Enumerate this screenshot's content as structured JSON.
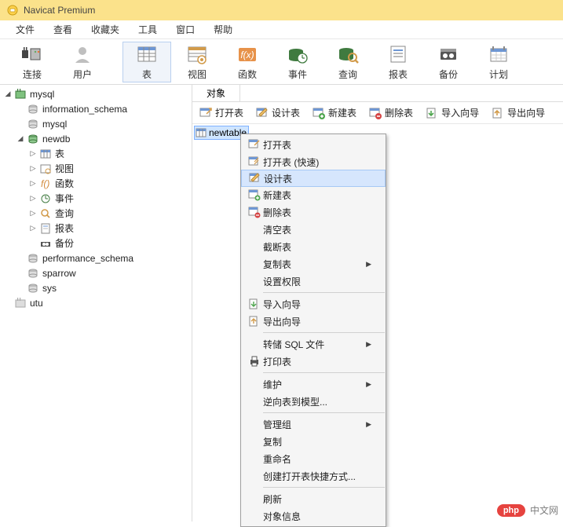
{
  "title": "Navicat Premium",
  "menubar": [
    "文件",
    "查看",
    "收藏夹",
    "工具",
    "窗口",
    "帮助"
  ],
  "toolbar": [
    {
      "id": "connect",
      "label": "连接",
      "icon": "plug"
    },
    {
      "id": "user",
      "label": "用户",
      "icon": "user"
    },
    {
      "id": "table",
      "label": "表",
      "icon": "table",
      "active": true
    },
    {
      "id": "view",
      "label": "视图",
      "icon": "view"
    },
    {
      "id": "function",
      "label": "函数",
      "icon": "fx"
    },
    {
      "id": "event",
      "label": "事件",
      "icon": "event"
    },
    {
      "id": "query",
      "label": "查询",
      "icon": "query"
    },
    {
      "id": "report",
      "label": "报表",
      "icon": "report"
    },
    {
      "id": "backup",
      "label": "备份",
      "icon": "backup"
    },
    {
      "id": "schedule",
      "label": "计划",
      "icon": "schedule"
    }
  ],
  "tree": {
    "mysql": {
      "label": "mysql",
      "children": {
        "information_schema": {
          "label": "information_schema"
        },
        "mysql": {
          "label": "mysql"
        },
        "newdb": {
          "label": "newdb",
          "expanded": true,
          "children": {
            "tables": {
              "label": "表"
            },
            "views": {
              "label": "视图"
            },
            "functions": {
              "label": "函数"
            },
            "events": {
              "label": "事件"
            },
            "queries": {
              "label": "查询"
            },
            "reports": {
              "label": "报表"
            },
            "backups": {
              "label": "备份"
            }
          }
        },
        "performance_schema": {
          "label": "performance_schema"
        },
        "sparrow": {
          "label": "sparrow"
        },
        "sys": {
          "label": "sys"
        }
      }
    },
    "utu": {
      "label": "utu"
    }
  },
  "tabs": {
    "object": "对象"
  },
  "toolbar2": {
    "open_table": "打开表",
    "design_table": "设计表",
    "new_table": "新建表",
    "delete_table": "删除表",
    "import_wizard": "导入向导",
    "export_wizard": "导出向导"
  },
  "selected_table": "newtable",
  "context_menu": {
    "open_table": "打开表",
    "open_table_fast": "打开表 (快速)",
    "design_table": "设计表",
    "new_table": "新建表",
    "delete_table": "删除表",
    "truncate_table": "清空表",
    "trunc_table2": "截断表",
    "copy_table": "复制表",
    "set_priv": "设置权限",
    "import_wizard": "导入向导",
    "export_wizard": "导出向导",
    "dump_sql": "转储 SQL 文件",
    "print_table": "打印表",
    "maintain": "维护",
    "reverse_model": "逆向表到模型...",
    "manage_group": "管理组",
    "copy": "复制",
    "rename": "重命名",
    "create_shortcut": "创建打开表快捷方式...",
    "refresh": "刷新",
    "object_info": "对象信息"
  },
  "watermark": {
    "badge": "php",
    "text": "中文网"
  }
}
